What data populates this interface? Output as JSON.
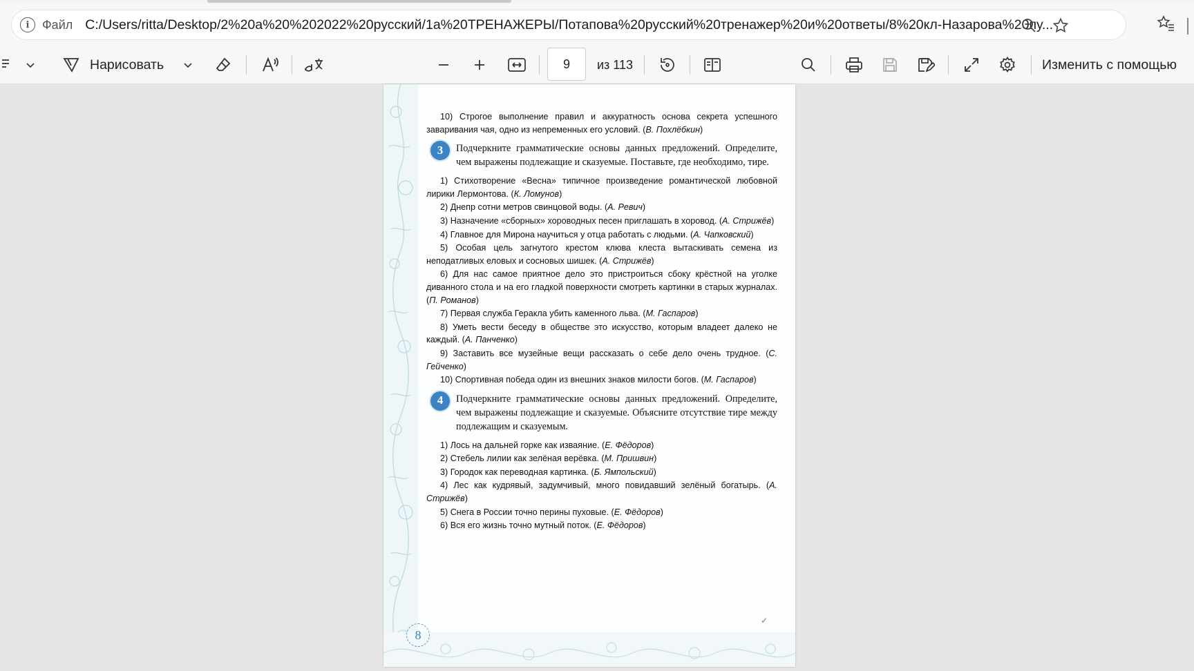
{
  "address_bar": {
    "scheme_label": "Файл",
    "url": "C:/Users/ritta/Desktop/2%20a%20%202022%20русский/1a%20ТРЕНАЖЕРЫ/Потапова%20русский%20тренажер%20и%20ответы/8%20кл-Назарова%20пу..."
  },
  "toolbar": {
    "draw_label": "Нарисовать",
    "page_current": "9",
    "page_total": "из 113",
    "edit_with_label": "Изменить с помощью"
  },
  "icons": {
    "info": "info-icon",
    "zoom_out_address": "zoom-out-icon",
    "favorite": "star-icon",
    "favorites_list": "favorites-icon",
    "highlight": "highlight-icon",
    "draw": "draw-icon",
    "erase": "eraser-icon",
    "read_aloud": "read-aloud-icon",
    "translate": "translate-icon",
    "zoom_minus": "minus-icon",
    "zoom_plus": "plus-icon",
    "fit": "fit-width-icon",
    "rotate": "rotate-icon",
    "two_page": "page-view-icon",
    "search": "search-icon",
    "print": "print-icon",
    "save": "save-icon",
    "save_as": "save-as-icon",
    "fullscreen": "fullscreen-icon",
    "settings": "gear-icon"
  },
  "document": {
    "page_number": "8",
    "lines": [
      {
        "text": "10) Строгое выполнение правил и аккуратность основа секрета успешного заваривания чая, одно из непременных его условий. (",
        "author": "В. Похлёбкин",
        "tail": ")"
      }
    ],
    "task3": {
      "number": "3",
      "text": "Подчеркните грамматические основы данных предложений. Определите, чем выражены подлежащие и сказуемые. Поставьте, где необходимо, тире.",
      "items": [
        {
          "text": "1) Стихотворение «Весна» типичное произведение романтической любовной лирики Лермонтова. (",
          "author": "К. Ломунов",
          "tail": ")"
        },
        {
          "text": "2) Днепр сотни метров свинцовой воды. (",
          "author": "А. Ревич",
          "tail": ")"
        },
        {
          "text": "3) Назначение «сборных» хороводных песен приглашать в хоровод. (",
          "author": "А. Стрижёв",
          "tail": ")"
        },
        {
          "text": "4) Главное для Мирона научиться у отца работать с людьми. (",
          "author": "А. Чапковский",
          "tail": ")"
        },
        {
          "text": "5) Особая цель загнутого крестом клюва клеста вытаскивать семена из неподатливых еловых и сосновых шишек. (",
          "author": "А. Стрижёв",
          "tail": ")"
        },
        {
          "text": "6) Для нас самое приятное дело это пристроиться сбоку крёстной на уголке диванного стола и на его гладкой поверхности смотреть картинки в старых журналах. (",
          "author": "П. Романов",
          "tail": ")"
        },
        {
          "text": "7) Первая служба Геракла убить каменного льва. (",
          "author": "М. Гаспаров",
          "tail": ")"
        },
        {
          "text": "8) Уметь вести беседу в обществе это искусство, которым владеет далеко не каждый. (",
          "author": "А. Панченко",
          "tail": ")"
        },
        {
          "text": "9) Заставить все музейные вещи рассказать о себе дело очень трудное. (",
          "author": "С. Гейченко",
          "tail": ")"
        },
        {
          "text": "10) Спортивная победа один из внешних знаков милости богов. (",
          "author": "М. Гаспаров",
          "tail": ")"
        }
      ]
    },
    "task4": {
      "number": "4",
      "text": "Подчеркните грамматические основы данных предложений. Определите, чем выражены подлежащие и сказуемые. Объясните отсутствие тире между подлежащим и сказуемым.",
      "items": [
        {
          "text": "1) Лось на дальней горке как изваяние. (",
          "author": "Е. Фёдоров",
          "tail": ")"
        },
        {
          "text": "2) Стебель лилии как зелёная верёвка. (",
          "author": "М. Пришвин",
          "tail": ")"
        },
        {
          "text": "3) Городок как переводная картинка. (",
          "author": "Б. Ямпольский",
          "tail": ")"
        },
        {
          "text": "4) Лес как кудрявый, задумчивый, много повидавший зелёный богатырь. (",
          "author": "А. Стрижёв",
          "tail": ")"
        },
        {
          "text": "5) Снега в России точно перины пуховые. (",
          "author": "Е. Фёдоров",
          "tail": ")"
        },
        {
          "text": "6) Вся его жизнь точно мутный поток. (",
          "author": "Е. Фёдоров",
          "tail": ")"
        }
      ]
    }
  },
  "colors": {
    "task_badge": "#3b83c3",
    "toolbar_bg": "#f7f7f7",
    "viewer_bg": "#e6e6e6"
  }
}
